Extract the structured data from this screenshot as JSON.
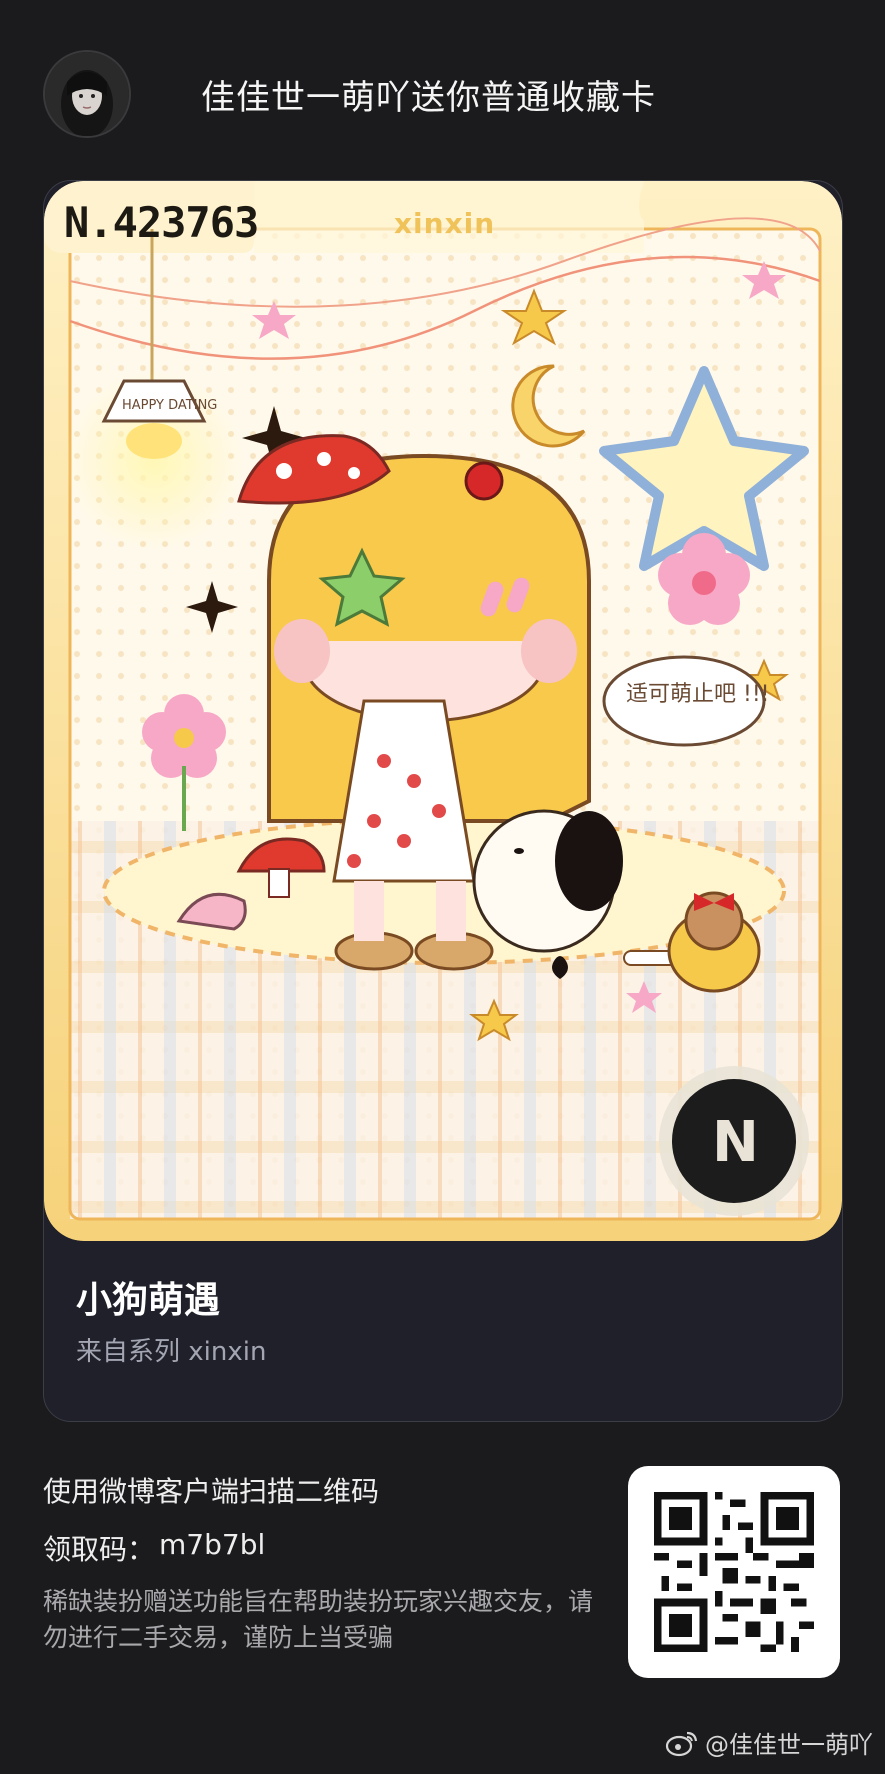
{
  "header": {
    "title": "佳佳世一萌吖送你普通收藏卡",
    "avatar": "user-avatar"
  },
  "card": {
    "number": "N.423763",
    "series_tag": "xinxin",
    "name": "小狗萌遇",
    "series_line": "来自系列 xinxin",
    "speech_bubble": "适可萌止吧 !!!",
    "lamp_sign": "HAPPY DATING",
    "logo_letter": "N"
  },
  "footer": {
    "scan_text": "使用微博客户端扫描二维码",
    "code_label": "领取码：",
    "code_value": "m7b7bl",
    "notice": "稀缺装扮赠送功能旨在帮助装扮玩家兴趣交友，请勿进行二手交易，谨防上当受骗",
    "watermark": "@佳佳世一萌吖"
  },
  "colors": {
    "background": "#1b1b1d",
    "card_panel": "#1f2029",
    "accent_gold": "#f0c25a"
  }
}
